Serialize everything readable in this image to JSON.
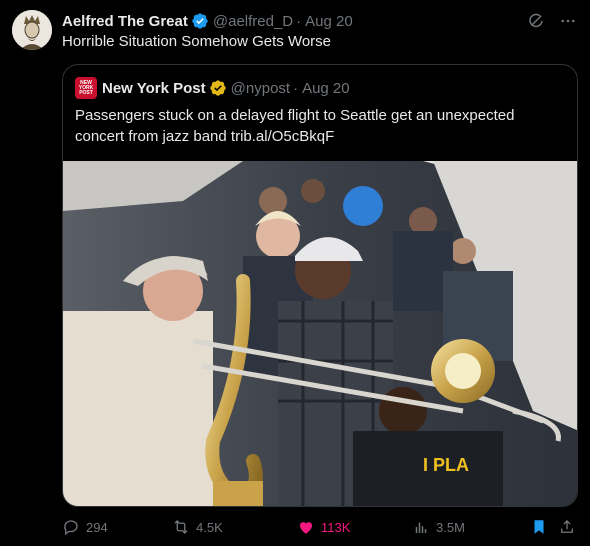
{
  "tweet": {
    "author": {
      "name": "Aelfred The Great",
      "handle": "@aelfred_D",
      "separator": "·",
      "date": "Aug 20"
    },
    "text": "Horrible Situation Somehow Gets Worse"
  },
  "quote": {
    "author": {
      "name": "New York Post",
      "handle": "@nypost",
      "separator": "·",
      "date": "Aug 20",
      "avatar_text": "NEW YORK POST"
    },
    "text": "Passengers stuck on a delayed flight to Seattle get an unexpected concert from jazz band trib.al/O5cBkqF"
  },
  "actions": {
    "replies": "294",
    "reposts": "4.5K",
    "likes": "113K",
    "views": "3.5M"
  },
  "colors": {
    "accent_blue": "#1d9bf0",
    "like_pink": "#f91880",
    "verified_gold": "#e2b719",
    "nypost_red": "#c8102e"
  },
  "icons": [
    "verified-badge-icon",
    "grok-icon",
    "more-icon",
    "reply-icon",
    "repost-icon",
    "like-icon",
    "views-icon",
    "bookmark-icon",
    "share-icon"
  ]
}
